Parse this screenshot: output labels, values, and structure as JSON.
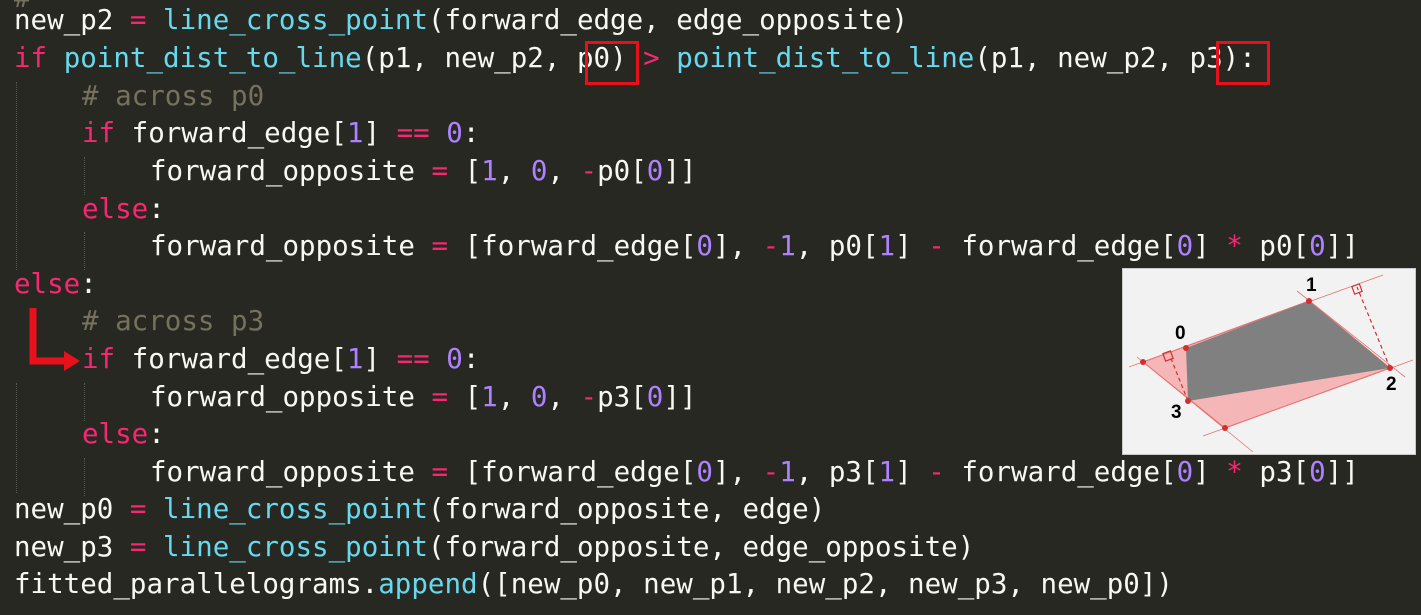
{
  "code": {
    "line_partial_top": "",
    "l1": {
      "a": "new_p2 ",
      "eq": "=",
      "sp": " ",
      "fn": "line_cross_point",
      "b": "(forward_edge, edge_opposite)"
    },
    "l2": {
      "if": "if",
      "sp": " ",
      "fn1": "point_dist_to_line",
      "b1": "(p1, new_p2, ",
      "p0": "p0",
      "b2": ")",
      "gt": " > ",
      "fn2": "point_dist_to_line",
      "b3": "(p1, new_p2, ",
      "p3": "p3",
      "b4": "):"
    },
    "l3": {
      "comment": "# across p0"
    },
    "l4": {
      "if": "if",
      "a": " forward_edge[",
      "n1": "1",
      "b": "] ",
      "eq": "==",
      "sp": " ",
      "n0": "0",
      "c": ":"
    },
    "l5": {
      "a": "forward_opposite ",
      "eq": "=",
      "b": " [",
      "n1": "1",
      "c": ", ",
      "n2": "0",
      "d": ", ",
      "minus": "-",
      "e": "p0[",
      "n3": "0",
      "f": "]]"
    },
    "l6": {
      "else": "else",
      "c": ":"
    },
    "l7": {
      "a": "forward_opposite ",
      "eq": "=",
      "b": " [forward_edge[",
      "n0": "0",
      "c": "], ",
      "minus": "-",
      "n1": "1",
      "d": ", p0[",
      "n2": "1",
      "e": "] ",
      "m": "-",
      "f": " forward_edge[",
      "n3": "0",
      "g": "] ",
      "star": "*",
      "h": " p0[",
      "n4": "0",
      "i": "]]"
    },
    "l8": {
      "else": "else",
      "c": ":"
    },
    "l9": {
      "comment": "# across p3"
    },
    "l10": {
      "if": "if",
      "a": " forward_edge[",
      "n1": "1",
      "b": "] ",
      "eq": "==",
      "sp": " ",
      "n0": "0",
      "c": ":"
    },
    "l11": {
      "a": "forward_opposite ",
      "eq": "=",
      "b": " [",
      "n1": "1",
      "c": ", ",
      "n2": "0",
      "d": ", ",
      "minus": "-",
      "e": "p3[",
      "n3": "0",
      "f": "]]"
    },
    "l12": {
      "else": "else",
      "c": ":"
    },
    "l13": {
      "a": "forward_opposite ",
      "eq": "=",
      "b": " [forward_edge[",
      "n0": "0",
      "c": "], ",
      "minus": "-",
      "n1": "1",
      "d": ", p3[",
      "n2": "1",
      "e": "] ",
      "m": "-",
      "f": " forward_edge[",
      "n3": "0",
      "g": "] ",
      "star": "*",
      "h": " p3[",
      "n4": "0",
      "i": "]]"
    },
    "l14": {
      "a": "new_p0 ",
      "eq": "=",
      "sp": " ",
      "fn": "line_cross_point",
      "b": "(forward_opposite, edge)"
    },
    "l15": {
      "a": "new_p3 ",
      "eq": "=",
      "sp": " ",
      "fn": "line_cross_point",
      "b": "(forward_opposite, edge_opposite)"
    },
    "l16": {
      "a": "fitted_parallelograms.",
      "fn": "append",
      "b": "([new_p0, new_p1, new_p2, new_p3, new_p0])"
    }
  },
  "diagram": {
    "labels": {
      "p0": "0",
      "p1": "1",
      "p2": "2",
      "p3": "3"
    }
  },
  "colors": {
    "background": "#272822",
    "keyword": "#f92672",
    "function": "#66d9ef",
    "number": "#ae81ff",
    "comment": "#75715e",
    "highlight": "#e8101a",
    "quad_fill": "#808080",
    "parallelogram_fill": "#f4b6b6"
  }
}
